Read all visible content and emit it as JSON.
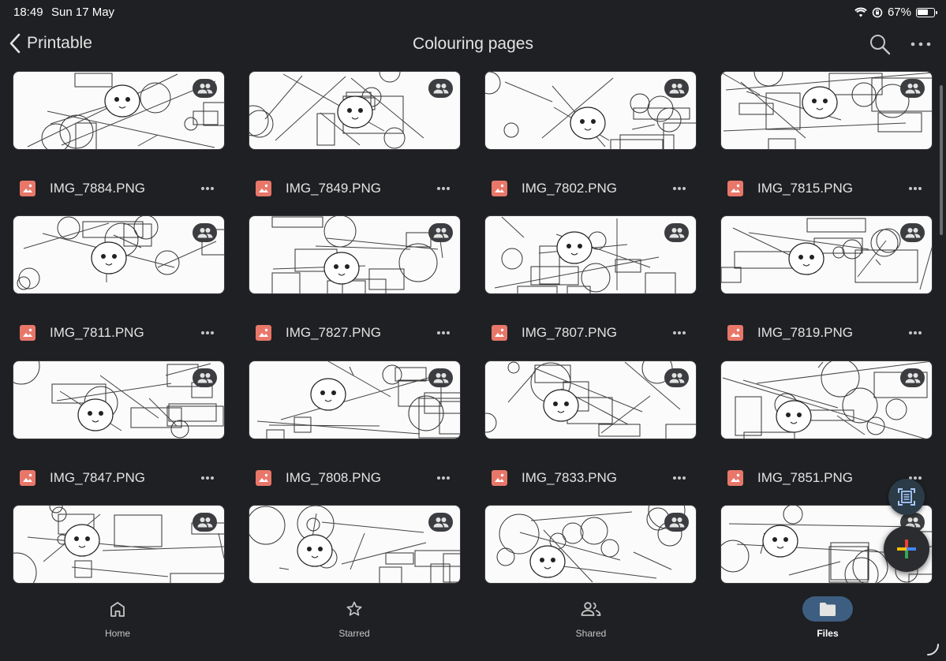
{
  "status_bar": {
    "time": "18:49",
    "date": "Sun 17 May",
    "battery": "67%",
    "battery_level": 0.67
  },
  "header": {
    "back_label": "Printable",
    "title": "Colouring pages"
  },
  "files": [
    {
      "name": "IMG_7884.PNG",
      "shared": true
    },
    {
      "name": "IMG_7849.PNG",
      "shared": true
    },
    {
      "name": "IMG_7802.PNG",
      "shared": true
    },
    {
      "name": "IMG_7815.PNG",
      "shared": true
    },
    {
      "name": "IMG_7811.PNG",
      "shared": true
    },
    {
      "name": "IMG_7827.PNG",
      "shared": true
    },
    {
      "name": "IMG_7807.PNG",
      "shared": true
    },
    {
      "name": "IMG_7819.PNG",
      "shared": true
    },
    {
      "name": "IMG_7847.PNG",
      "shared": true
    },
    {
      "name": "IMG_7808.PNG",
      "shared": true
    },
    {
      "name": "IMG_7833.PNG",
      "shared": true
    },
    {
      "name": "IMG_7851.PNG",
      "shared": true
    }
  ],
  "bottom_nav": [
    {
      "label": "Home",
      "icon": "home-icon",
      "active": false
    },
    {
      "label": "Starred",
      "icon": "star-icon",
      "active": false
    },
    {
      "label": "Shared",
      "icon": "shared-icon",
      "active": false
    },
    {
      "label": "Files",
      "icon": "folder-icon",
      "active": true
    }
  ],
  "colors": {
    "background": "#1f2023",
    "file_icon": "#e8776a",
    "active_nav": "#3d5e80",
    "fab_plus": [
      "#ea4335",
      "#fbbc04",
      "#34a853",
      "#4285f4"
    ]
  }
}
